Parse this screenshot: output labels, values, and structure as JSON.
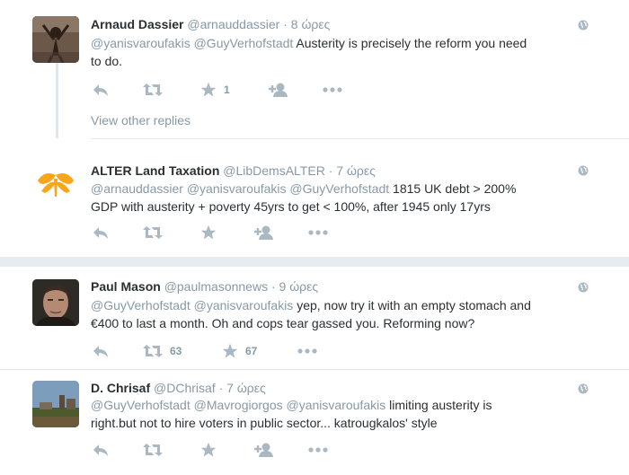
{
  "tweets": [
    {
      "name": "Arnaud Dassier",
      "handle": "@arnauddassier",
      "sep": "·",
      "time": "8 ώρες",
      "mentions": "@yanisvaroufakis @GuyVerhofstadt",
      "text_a": " Austerity is precisely the reform you need",
      "text_b": "to do.",
      "likes": "1",
      "retweets": ""
    },
    {
      "name": "ALTER Land Taxation",
      "handle": "@LibDemsALTER",
      "sep": "·",
      "time": "7 ώρες",
      "mentions": "@arnauddassier @yanisvaroufakis @GuyVerhofstadt",
      "text_a": " 1815 UK debt > 200%",
      "text_b": "GDP with austerity + poverty 45yrs to get < 100%, after 1945 only 17yrs",
      "likes": "",
      "retweets": ""
    },
    {
      "name": "Paul Mason",
      "handle": "@paulmasonnews",
      "sep": "·",
      "time": "9 ώρες",
      "mentions": "@GuyVerhofstadt @yanisvaroufakis",
      "text_a": " yep, now try it with an empty stomach and",
      "text_b": "€400 to last a month. Oh and cops tear gassed you. Reforming now?",
      "likes": "67",
      "retweets": "63"
    },
    {
      "name": "D. Chrisaf",
      "handle": "@DChrisaf",
      "sep": "·",
      "time": "7 ώρες",
      "mentions": "@GuyVerhofstadt @Mavrogiorgos @yanisvaroufakis",
      "text_a": "  limiting austerity is",
      "text_b": "right.but not to hire voters in public sector... katrougkalos' style",
      "likes": "",
      "retweets": ""
    }
  ],
  "view_other_replies": "View other replies",
  "icons": {
    "reply": "reply-icon",
    "retweet": "retweet-icon",
    "like": "star-icon",
    "follow": "follow-icon",
    "more": "more-icon",
    "globe": "globe-icon"
  },
  "colors": {
    "icon": "#aab8c2",
    "muted": "#8899a6",
    "text": "#292f33",
    "background": "#e6ecf0",
    "libdem_orange": "#faa61a"
  }
}
